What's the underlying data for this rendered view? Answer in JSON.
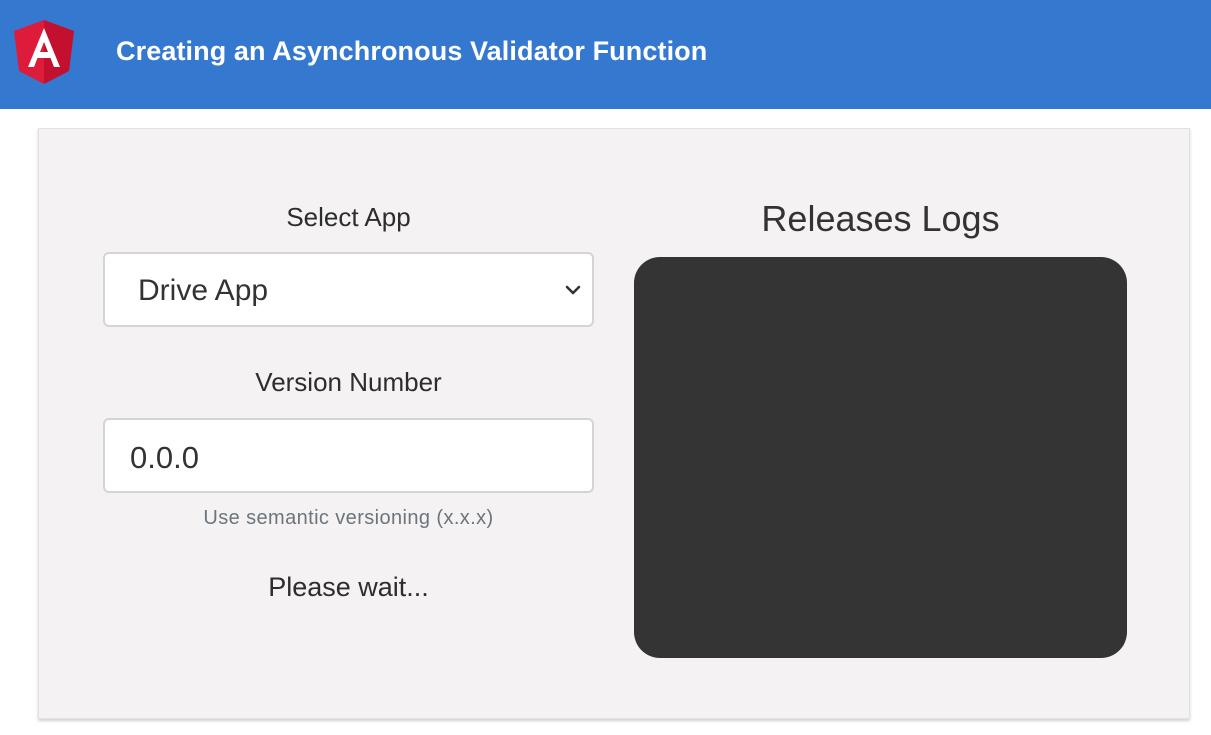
{
  "header": {
    "title": "Creating an Asynchronous Validator Function",
    "logo_icon": "angular-logo-icon",
    "background_color": "#3578cf"
  },
  "form": {
    "app_label": "Select App",
    "app_selected": "Drive App",
    "version_label": "Version Number",
    "version_value": "0.0.0",
    "version_hint": "Use semantic versioning (x.x.x)",
    "status_text": "Please wait..."
  },
  "logs": {
    "title": "Releases Logs",
    "panel_color": "#343434"
  }
}
